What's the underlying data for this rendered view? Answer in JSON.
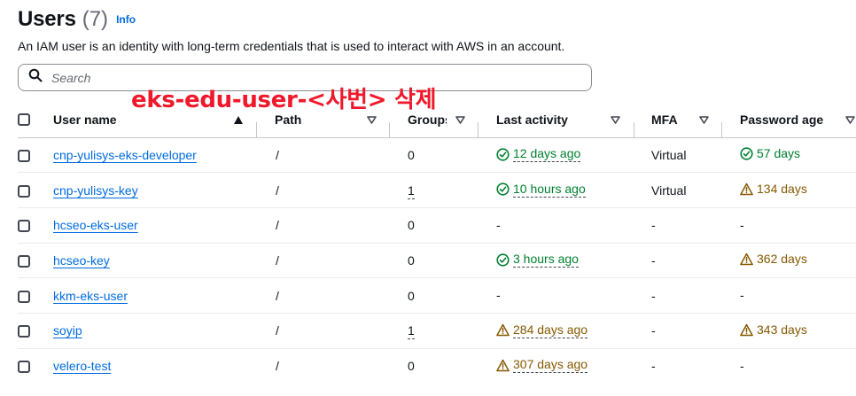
{
  "header": {
    "title": "Users",
    "count": "(7)",
    "info_link": "Info"
  },
  "description": "An IAM user is an identity with long-term credentials that is used to interact with AWS in an account.",
  "search": {
    "placeholder": "Search",
    "value": ""
  },
  "annotation": "eks-edu-user-<사번> 삭제",
  "table": {
    "columns": [
      "User name",
      "Path",
      "Groups",
      "Last activity",
      "MFA",
      "Password age"
    ],
    "rows": [
      {
        "user_name": "cnp-yulisys-eks-developer",
        "path": "/",
        "groups": "0",
        "last_activity": "12 days ago",
        "last_activity_status": "ok",
        "mfa": "Virtual",
        "password_age": "57 days",
        "password_status": "ok"
      },
      {
        "user_name": "cnp-yulisys-key",
        "path": "/",
        "groups": "1",
        "last_activity": "10 hours ago",
        "last_activity_status": "ok",
        "mfa": "Virtual",
        "password_age": "134 days",
        "password_status": "warn"
      },
      {
        "user_name": "hcseo-eks-user",
        "path": "/",
        "groups": "0",
        "last_activity": "-",
        "last_activity_status": "none",
        "mfa": "-",
        "password_age": "-",
        "password_status": "none"
      },
      {
        "user_name": "hcseo-key",
        "path": "/",
        "groups": "0",
        "last_activity": "3 hours ago",
        "last_activity_status": "ok",
        "mfa": "-",
        "password_age": "362 days",
        "password_status": "warn"
      },
      {
        "user_name": "kkm-eks-user",
        "path": "/",
        "groups": "0",
        "last_activity": "-",
        "last_activity_status": "none",
        "mfa": "-",
        "password_age": "-",
        "password_status": "none"
      },
      {
        "user_name": "soyip",
        "path": "/",
        "groups": "1",
        "last_activity": "284 days ago",
        "last_activity_status": "warn",
        "mfa": "-",
        "password_age": "343 days",
        "password_status": "warn"
      },
      {
        "user_name": "velero-test",
        "path": "/",
        "groups": "0",
        "last_activity": "307 days ago",
        "last_activity_status": "warn",
        "mfa": "-",
        "password_age": "-",
        "password_status": "none"
      }
    ]
  },
  "icons": {
    "search": "search-icon",
    "sort_ascending": "caret-up-icon",
    "sort_descending": "caret-down-icon",
    "status_ok": "check-circle-icon",
    "status_warning": "warning-triangle-icon"
  },
  "colors": {
    "link": "#006ce0",
    "success": "#00802f",
    "warning": "#855900",
    "annotation": "#f0182b"
  }
}
